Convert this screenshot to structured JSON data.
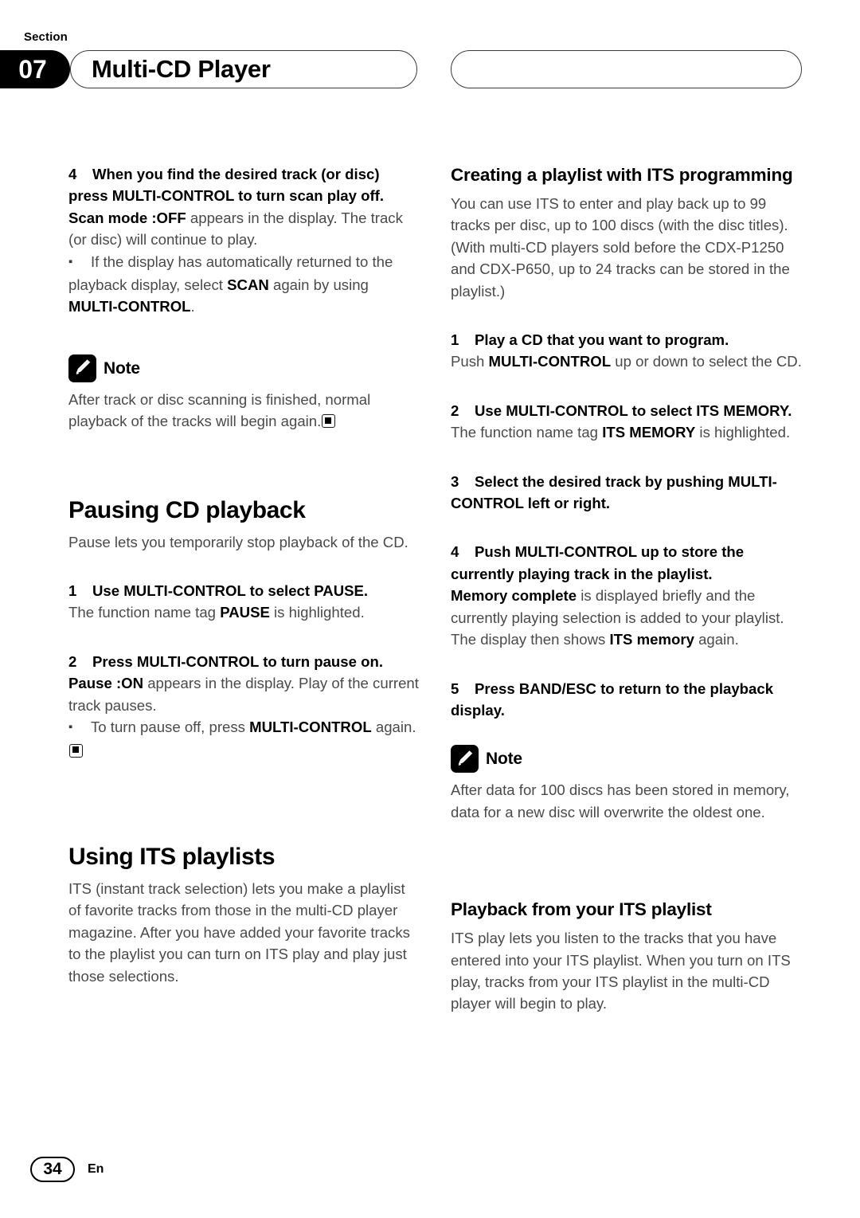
{
  "header": {
    "section_label": "Section",
    "section_number": "07",
    "title": "Multi-CD Player"
  },
  "left_column": {
    "step4": {
      "num": "4",
      "title": "When you find the desired track (or disc) press MULTI-CONTROL to turn scan play off.",
      "body_bold": "Scan mode :OFF",
      "body_rest": " appears in the display. The track (or disc) will continue to play."
    },
    "bullet_scan": {
      "part1": "If the display has automatically returned to the playback display, select ",
      "bold1": "SCAN",
      "part2": " again by using ",
      "bold2": "MULTI-CONTROL",
      "part3": "."
    },
    "note": {
      "label": "Note",
      "text": "After track or disc scanning is finished, normal playback of the tracks will begin again."
    },
    "pausing": {
      "heading": "Pausing CD playback",
      "intro": "Pause lets you temporarily stop playback of the CD.",
      "step1": {
        "num": "1",
        "title": "Use MULTI-CONTROL to select PAUSE.",
        "body_part1": "The function name tag ",
        "body_bold": "PAUSE",
        "body_part2": " is highlighted."
      },
      "step2": {
        "num": "2",
        "title": "Press MULTI-CONTROL to turn pause on.",
        "body_bold": "Pause :ON",
        "body_rest": " appears in the display. Play of the current track pauses."
      },
      "bullet": {
        "part1": "To turn pause off, press ",
        "bold1": "MULTI-CONTROL",
        "part2": " again."
      }
    },
    "using_its": {
      "heading": "Using ITS playlists",
      "body": "ITS (instant track selection) lets you make a playlist of favorite tracks from those in the multi-CD player magazine. After you have added your favorite tracks to the playlist you can turn on ITS play and play just those selections."
    }
  },
  "right_column": {
    "creating": {
      "heading": "Creating a playlist with ITS programming",
      "body": "You can use ITS to enter and play back up to 99 tracks per disc, up to 100 discs (with the disc titles). (With multi-CD players sold before the CDX-P1250 and CDX-P650, up to 24 tracks can be stored in the playlist.)"
    },
    "step1": {
      "num": "1",
      "title": "Play a CD that you want to program.",
      "body_part1": "Push ",
      "body_bold": "MULTI-CONTROL",
      "body_part2": " up or down to select the CD."
    },
    "step2": {
      "num": "2",
      "title": "Use MULTI-CONTROL to select ITS MEMORY.",
      "body_part1": "The function name tag ",
      "body_bold": "ITS MEMORY",
      "body_part2": " is highlighted."
    },
    "step3": {
      "num": "3",
      "title": "Select the desired track by pushing MULTI-CONTROL left or right."
    },
    "step4": {
      "num": "4",
      "title": "Push MULTI-CONTROL up to store the currently playing track in the playlist.",
      "body_bold1": "Memory complete",
      "body_part1": " is displayed briefly and the currently playing selection is added to your playlist. The display then shows ",
      "body_bold2": "ITS memory",
      "body_part2": " again."
    },
    "step5": {
      "num": "5",
      "title": "Press BAND/ESC to return to the playback display."
    },
    "note": {
      "label": "Note",
      "text": "After data for 100 discs has been stored in memory, data for a new disc will overwrite the oldest one."
    },
    "playback": {
      "heading": "Playback from your ITS playlist",
      "body": "ITS play lets you listen to the tracks that you have entered into your ITS playlist. When you turn on ITS play, tracks from your ITS playlist in the multi-CD player will begin to play."
    }
  },
  "footer": {
    "page_number": "34",
    "language": "En"
  }
}
